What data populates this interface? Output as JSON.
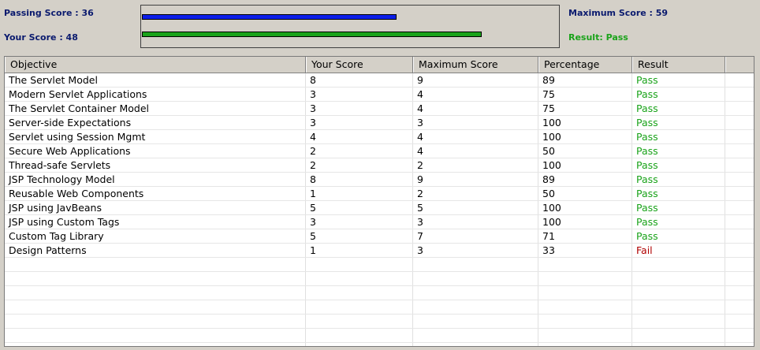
{
  "summary": {
    "passing_score_text": "Passing Score : 36",
    "your_score_text": "Your Score : 48",
    "maximum_score_text": "Maximum Score : 59",
    "result_text": "Result: Pass",
    "passing_score": 36,
    "your_score": 48,
    "maximum_score": 59
  },
  "colors": {
    "passing_bar": "#0b1ee8",
    "your_bar": "#1aa31a",
    "pass": "#1aa31a",
    "fail": "#b00000"
  },
  "table": {
    "columns": [
      "Objective",
      "Your Score",
      "Maximum Score",
      "Percentage",
      "Result",
      ""
    ],
    "rows": [
      [
        "The Servlet Model",
        "8",
        "9",
        "89",
        "Pass"
      ],
      [
        "Modern Servlet Applications",
        "3",
        "4",
        "75",
        "Pass"
      ],
      [
        "The Servlet Container Model",
        "3",
        "4",
        "75",
        "Pass"
      ],
      [
        "Server-side Expectations",
        "3",
        "3",
        "100",
        "Pass"
      ],
      [
        "Servlet using Session Mgmt",
        "4",
        "4",
        "100",
        "Pass"
      ],
      [
        "Secure Web Applications",
        "2",
        "4",
        "50",
        "Pass"
      ],
      [
        "Thread-safe Servlets",
        "2",
        "2",
        "100",
        "Pass"
      ],
      [
        "JSP Technology Model",
        "8",
        "9",
        "89",
        "Pass"
      ],
      [
        "Reusable Web Components",
        "1",
        "2",
        "50",
        "Pass"
      ],
      [
        "JSP using JavBeans",
        "5",
        "5",
        "100",
        "Pass"
      ],
      [
        "JSP using Custom Tags",
        "3",
        "3",
        "100",
        "Pass"
      ],
      [
        "Custom Tag Library",
        "5",
        "7",
        "71",
        "Pass"
      ],
      [
        "Design Patterns",
        "1",
        "3",
        "33",
        "Fail"
      ]
    ],
    "empty_rows": 7
  }
}
